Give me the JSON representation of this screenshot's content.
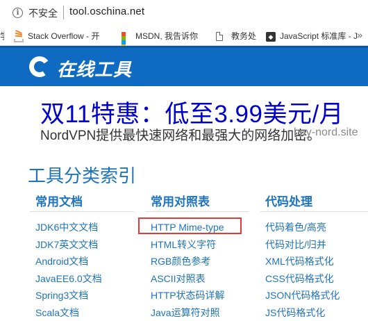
{
  "browser": {
    "security_label": "不安全",
    "url": "tool.oschina.net"
  },
  "bookmarks": [
    {
      "label": "Stack Overflow - 开",
      "icon": "stackoverflow-icon"
    },
    {
      "label": "MSDN, 我告诉你",
      "icon": "msdn-icon"
    },
    {
      "label": "教务处",
      "icon": "document-icon"
    },
    {
      "label": "JavaScript 标准库 - J",
      "icon": "javascript-icon"
    }
  ],
  "bookmark_clipped": "学",
  "header": {
    "logo_text": "在线工具"
  },
  "ad": {
    "title": "双11特惠：低至3.99美元/月",
    "description": "NordVPN提供最快速网络和最强大的网络加密。",
    "url": "buy-nord.site"
  },
  "section": {
    "title": "工具分类索引"
  },
  "columns": [
    {
      "heading": "常用文档",
      "items": [
        "JDK6中文文档",
        "JDK7英文文档",
        "Android文档",
        "JavaEE6.0文档",
        "Spring3文档",
        "Scala文档"
      ]
    },
    {
      "heading": "常用对照表",
      "items": [
        "HTTP Mime-type",
        "HTML转义字符",
        "RGB颜色参考",
        "ASCII对照表",
        "HTTP状态码详解",
        "Java运算符对照"
      ]
    },
    {
      "heading": "代码处理",
      "items": [
        "代码着色/高亮",
        "代码对比/归并",
        "XML代码格式化",
        "CSS代码格式化",
        "JSON代码格式化",
        "JS代码格式化"
      ]
    }
  ],
  "colors": {
    "header_blue": "#0f6bc2",
    "link_blue": "#1e73be",
    "ad_blue": "#0000cc",
    "highlight_red": "#e53935"
  }
}
